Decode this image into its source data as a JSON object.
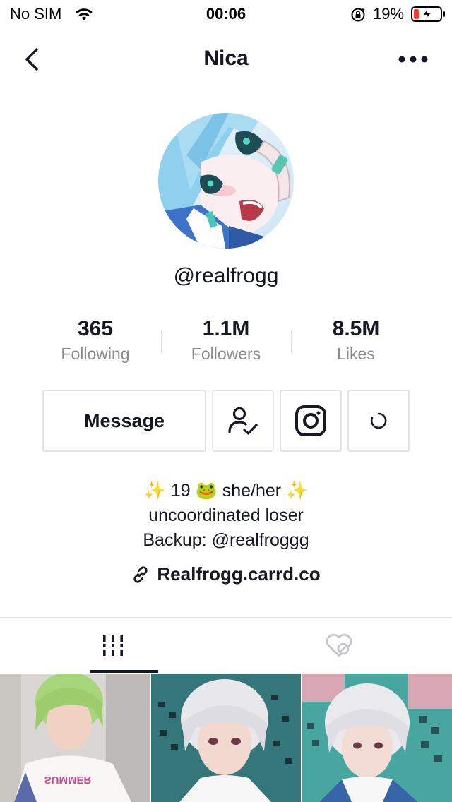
{
  "status_bar": {
    "carrier": "No SIM",
    "time": "00:06",
    "battery_percent": "19%"
  },
  "nav": {
    "title": "Nica",
    "back_icon": "chevron-left-icon",
    "more_icon": "more-horizontal-icon"
  },
  "profile": {
    "handle": "@realfrogg",
    "stats": [
      {
        "value": "365",
        "label": "Following"
      },
      {
        "value": "1.1M",
        "label": "Followers"
      },
      {
        "value": "8.5M",
        "label": "Likes"
      }
    ],
    "actions": {
      "message_label": "Message",
      "friend_icon": "user-check-icon",
      "instagram_icon": "instagram-icon",
      "more_icon": "loading-icon"
    },
    "bio": {
      "line1": "✨ 19 🐸 she/her ✨",
      "line2": "uncoordinated loser",
      "line3": "Backup: @realfroggg"
    },
    "link": {
      "icon": "link-icon",
      "text": "Realfrogg.carrd.co"
    }
  },
  "tabs": [
    {
      "icon": "grid-icon",
      "active": true
    },
    {
      "icon": "liked-hidden-icon",
      "active": false
    }
  ],
  "videos": [
    {
      "thumb": "video-thumbnail-1"
    },
    {
      "thumb": "video-thumbnail-2"
    },
    {
      "thumb": "video-thumbnail-3"
    }
  ],
  "colors": {
    "text_primary": "#161823",
    "text_secondary": "#8a8b91",
    "border": "#e3e3e4",
    "battery_low": "#ff3b30"
  }
}
